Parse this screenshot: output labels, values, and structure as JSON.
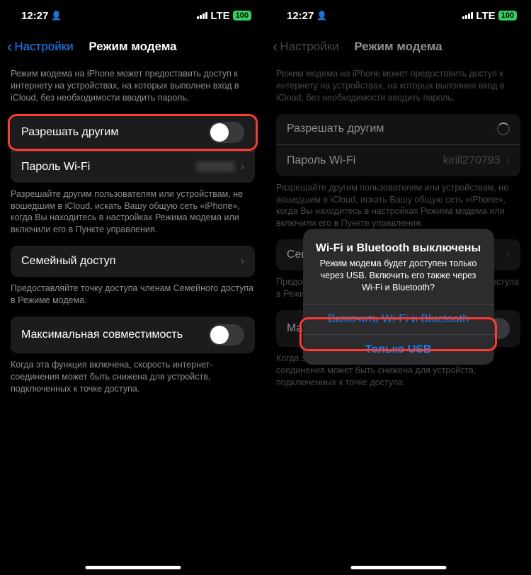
{
  "status": {
    "time": "12:27",
    "network_type": "LTE",
    "battery_pct": "100"
  },
  "left": {
    "back": "Настройки",
    "title": "Режим модема",
    "intro": "Режим модема на iPhone может предоставить доступ к интернету на устройствах, на которых выполнен вход в iCloud, без необходимости вводить пароль.",
    "allow_others": "Разрешать другим",
    "wifi_password_label": "Пароль Wi-Fi",
    "allow_explain": "Разрешайте другим пользователям или устройствам, не вошедшим в iCloud, искать Вашу общую сеть «iPhone», когда Вы находитесь в настройках Режима модема или включили его в Пункте управления.",
    "family_access": "Семейный доступ",
    "family_explain": "Предоставляйте точку доступа членам Семейного доступа в Режиме модема.",
    "max_compat": "Максимальная совместимость",
    "max_explain": "Когда эта функция включена, скорость интернет-соединения может быть снижена для устройств, подключенных к точке доступа."
  },
  "right": {
    "back": "Настройки",
    "title": "Режим модема",
    "intro": "Режим модема на iPhone может предоставить доступ к интернету на устройствах, на которых выполнен вход в iCloud, без необходимости вводить пароль.",
    "allow_others": "Разрешать другим",
    "wifi_password_label": "Пароль Wi-Fi",
    "wifi_password_value": "kirill270793",
    "allow_explain": "Разрешайте другим пользователям или устройствам, не вошедшим в iCloud, искать Вашу общую сеть «iPhone», когда Вы находитесь в настройках Режима модема или включили его в Пункте управления.",
    "family_access": "Семейный доступ",
    "family_explain": "Предоставляйте точку доступа членам Семейного доступа в Режиме модема.",
    "max_compat": "Максимальная совместимость",
    "max_explain": "Когда эта функция включена, скорость интернет-соединения может быть снижена для устройств, подключенных к точке доступа.",
    "alert": {
      "title": "Wi-Fi и Bluetooth выключены",
      "message": "Режим модема будет доступен только через USB. Включить его также через Wi-Fi и Bluetooth?",
      "primary": "Включить Wi-Fi и Bluetooth",
      "secondary": "Только USB"
    }
  }
}
